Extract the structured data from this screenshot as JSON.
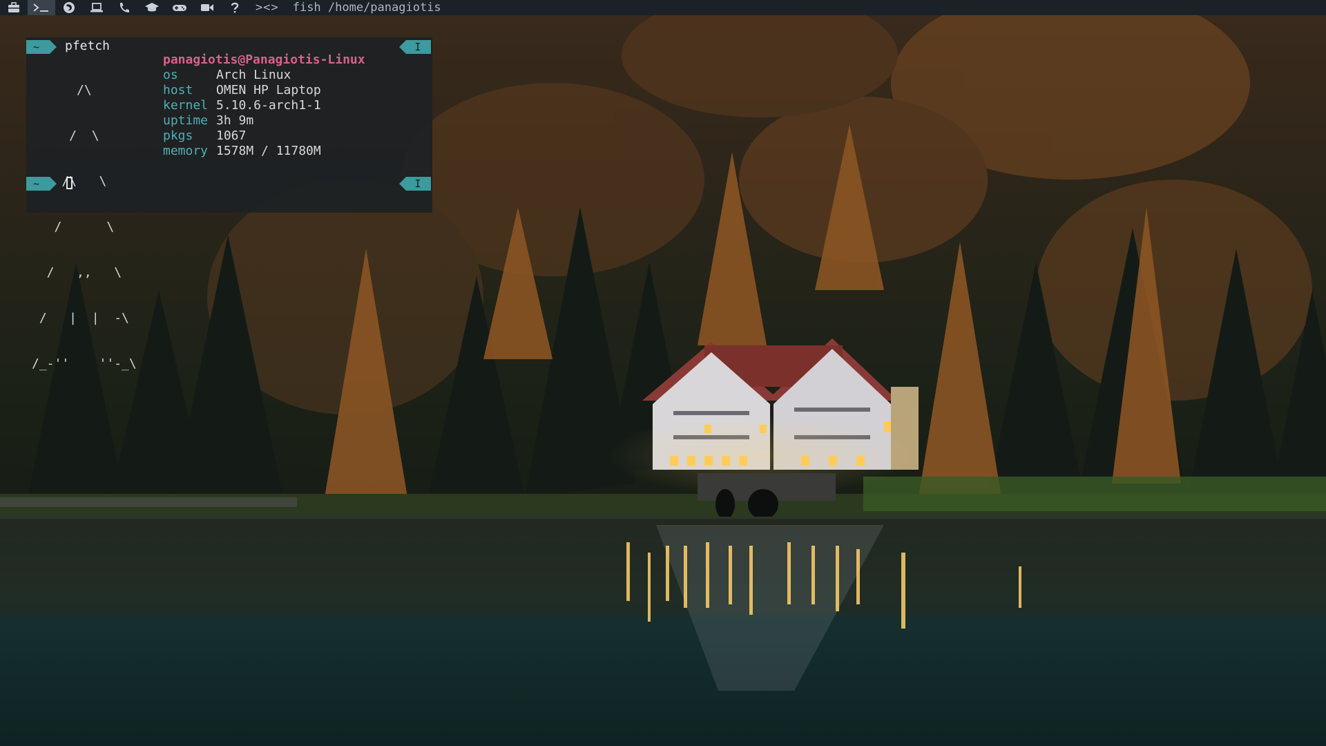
{
  "topbar": {
    "workspaces": [
      {
        "icon": "briefcase-icon",
        "active": false
      },
      {
        "icon": "terminal-icon",
        "active": true
      },
      {
        "icon": "firefox-icon",
        "active": false
      },
      {
        "icon": "laptop-icon",
        "active": false
      },
      {
        "icon": "phone-icon",
        "active": false
      },
      {
        "icon": "graduation-cap-icon",
        "active": false
      },
      {
        "icon": "gamepad-icon",
        "active": false
      },
      {
        "icon": "video-camera-icon",
        "active": false
      },
      {
        "icon": "question-icon",
        "active": false
      }
    ],
    "layout_indicator": "><>",
    "window_title": "fish /home/panagiotis"
  },
  "terminal": {
    "prompt_dir": "~",
    "prompt_mode": "I",
    "command": "pfetch",
    "logo_lines": [
      "      /\\",
      "     /  \\",
      "    /\\   \\",
      "   /      \\",
      "  /   ,,   \\",
      " /   |  |  -\\",
      "/_-''    ''-_\\"
    ],
    "userhost": "panagiotis@Panagiotis-Linux",
    "info": [
      {
        "key": "os",
        "value": "Arch Linux"
      },
      {
        "key": "host",
        "value": "OMEN HP Laptop"
      },
      {
        "key": "kernel",
        "value": "5.10.6-arch1-1"
      },
      {
        "key": "uptime",
        "value": "3h 9m"
      },
      {
        "key": "pkgs",
        "value": "1067"
      },
      {
        "key": "memory",
        "value": "1578M / 11780M"
      }
    ]
  },
  "colors": {
    "bar_bg": "#1b2126",
    "terminal_bg": "#1e2123",
    "accent": "#3d9a9e",
    "userhost": "#d6628e",
    "keys": "#4fb1b4"
  }
}
